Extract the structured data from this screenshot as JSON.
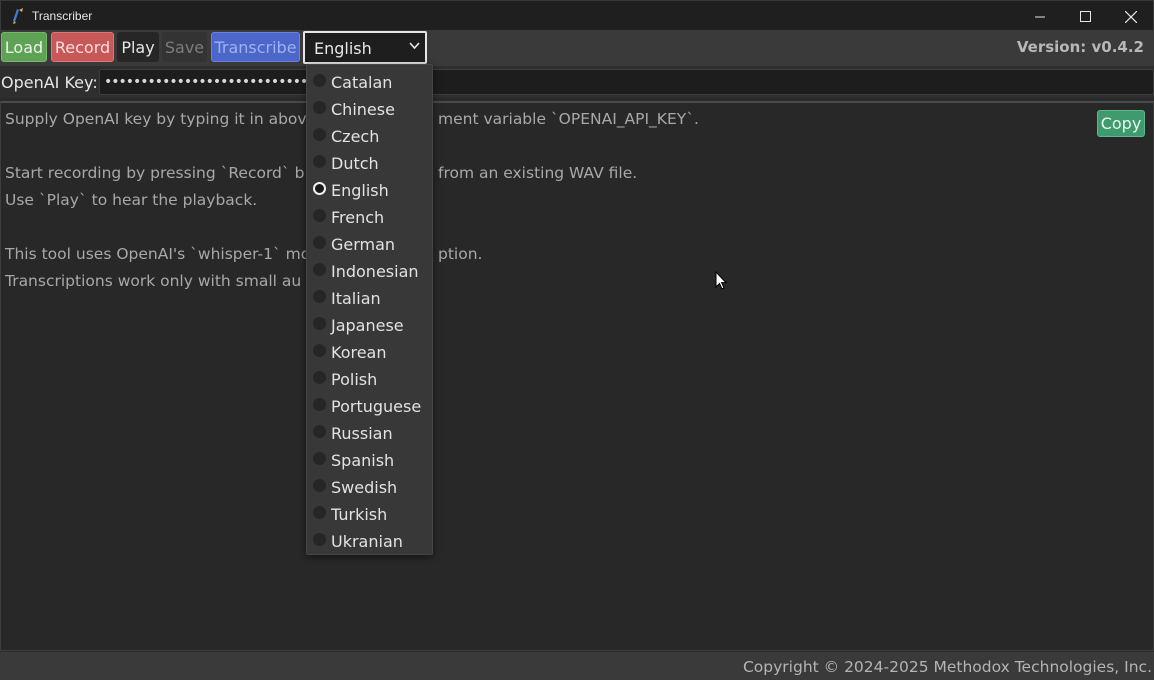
{
  "window": {
    "title": "Transcriber"
  },
  "toolbar": {
    "load_label": "Load",
    "record_label": "Record",
    "play_label": "Play",
    "save_label": "Save",
    "transcribe_label": "Transcribe",
    "language_selected": "English",
    "version": "Version: v0.4.2"
  },
  "key_row": {
    "label": "OpenAI Key:",
    "masked_value": "••••••••••••••••••••••••••••••••••••••••"
  },
  "textarea": {
    "lines": [
      "Supply OpenAI key by typing it in above",
      "ment variable `OPENAI_API_KEY`.",
      "Start recording by pressing `Record` b",
      "from an existing WAV file.",
      "Use `Play` to hear the playback.",
      "This tool uses OpenAI's `whisper-1` mo",
      "ption.",
      "Transcriptions work only with small au"
    ],
    "copy_label": "Copy"
  },
  "footer": {
    "copyright": "Copyright © 2024-2025 Methodox Technologies, Inc."
  },
  "dropdown": {
    "options": [
      "Catalan",
      "Chinese",
      "Czech",
      "Dutch",
      "English",
      "French",
      "German",
      "Indonesian",
      "Italian",
      "Japanese",
      "Korean",
      "Polish",
      "Portuguese",
      "Russian",
      "Spanish",
      "Swedish",
      "Turkish",
      "Ukranian"
    ],
    "selected": "English"
  }
}
